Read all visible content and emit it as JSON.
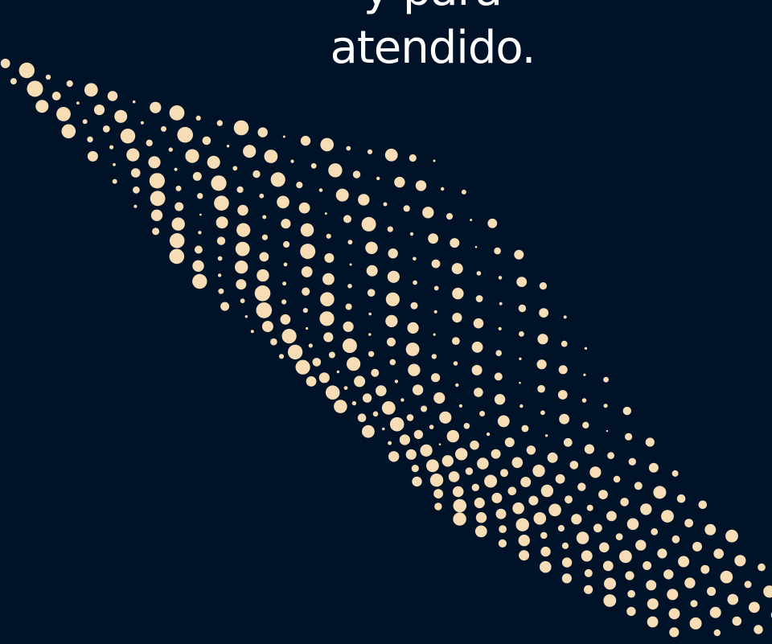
{
  "headline": {
    "lines": [
      "y para",
      "atendido."
    ]
  },
  "colors": {
    "background": "#001228",
    "dot": "#f6ddb6",
    "text": "#ffffff"
  }
}
